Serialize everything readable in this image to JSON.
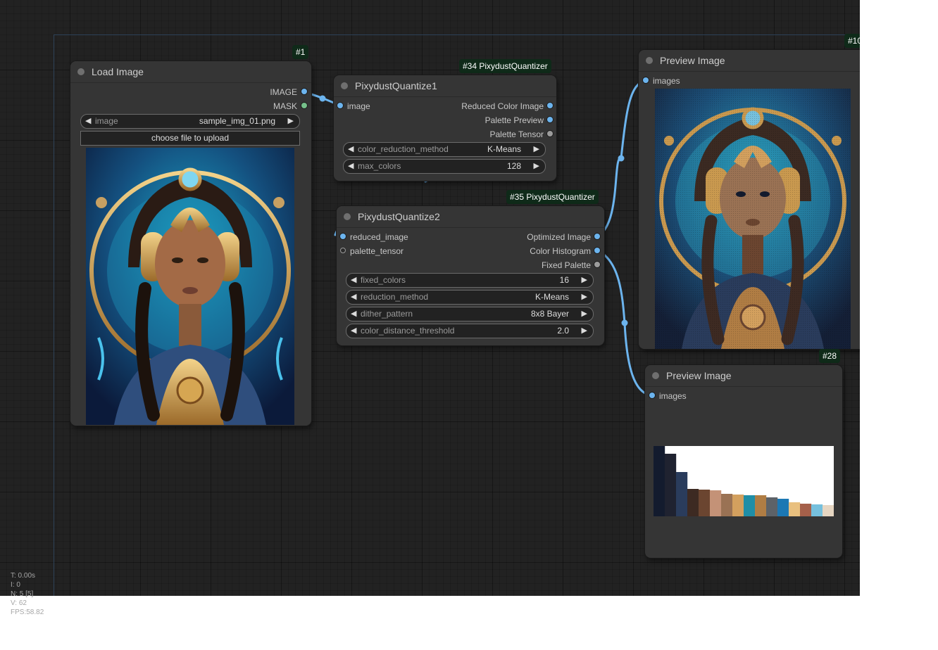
{
  "nodes": {
    "load_image": {
      "badge": "#1",
      "title": "Load Image",
      "outputs": [
        "IMAGE",
        "MASK"
      ],
      "widget_image_name": "image",
      "widget_image_value": "sample_img_01.png",
      "upload_label": "choose file to upload",
      "image_alt": "Art-deco portrait of a woman with golden headphones and blue background"
    },
    "quantize1": {
      "badge": "#34 PixydustQuantizer",
      "title": "PixydustQuantize1",
      "input": "image",
      "outputs": [
        "Reduced Color Image",
        "Palette Preview",
        "Palette Tensor"
      ],
      "widgets": [
        {
          "name": "color_reduction_method",
          "value": "K-Means"
        },
        {
          "name": "max_colors",
          "value": "128"
        }
      ]
    },
    "quantize2": {
      "badge": "#35 PixydustQuantizer",
      "title": "PixydustQuantize2",
      "inputs": [
        "reduced_image",
        "palette_tensor"
      ],
      "outputs": [
        "Optimized Image",
        "Color Histogram",
        "Fixed Palette"
      ],
      "widgets": [
        {
          "name": "fixed_colors",
          "value": "16"
        },
        {
          "name": "reduction_method",
          "value": "K-Means"
        },
        {
          "name": "dither_pattern",
          "value": "8x8 Bayer"
        },
        {
          "name": "color_distance_threshold",
          "value": "2.0"
        }
      ]
    },
    "preview10": {
      "badge": "#10",
      "title": "Preview Image",
      "input": "images"
    },
    "preview28": {
      "badge": "#28",
      "title": "Preview Image",
      "input": "images"
    }
  },
  "histogram": {
    "colors": [
      "#131b2e",
      "#1f2230",
      "#2a3c5c",
      "#3d2a22",
      "#6b4530",
      "#c49277",
      "#9a7254",
      "#d3a05e",
      "#1f8ea6",
      "#b07d44",
      "#5d6268",
      "#1c78b4",
      "#e9c07f",
      "#a5604a",
      "#76c0dd",
      "#e6d6c2"
    ],
    "values": [
      1.0,
      0.89,
      0.63,
      0.39,
      0.38,
      0.37,
      0.32,
      0.31,
      0.3,
      0.3,
      0.27,
      0.25,
      0.2,
      0.18,
      0.17,
      0.16
    ]
  },
  "stats": {
    "t": "T: 0.00s",
    "i": "I: 0",
    "n": "N: 5 [5]",
    "v": "V: 62",
    "fps": "FPS:58.82"
  },
  "colors": {
    "link": "#6cb4ee",
    "canvas": "#222222",
    "node": "#353535",
    "badge_bg": "#0f2a19"
  }
}
